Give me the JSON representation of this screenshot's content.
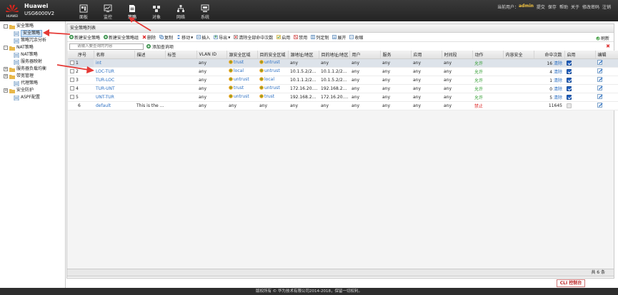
{
  "header": {
    "brand_name": "Huawei",
    "brand_model": "USG6000V2",
    "logo_text": "HUAWEI",
    "nav": [
      {
        "label": "面板",
        "icon": "dashboard-icon"
      },
      {
        "label": "监控",
        "icon": "monitor-icon"
      },
      {
        "label": "策略",
        "icon": "policy-icon"
      },
      {
        "label": "对象",
        "icon": "object-icon"
      },
      {
        "label": "网络",
        "icon": "network-icon"
      },
      {
        "label": "系统",
        "icon": "system-icon"
      }
    ],
    "current_user_label": "当前用户：",
    "current_user": "admin",
    "links": [
      "提交",
      "保存",
      "帮助",
      "关于",
      "修改密码",
      "注销"
    ]
  },
  "sidebar": {
    "items": [
      {
        "label": "安全策略",
        "level": 1,
        "expand": "-"
      },
      {
        "label": "安全策略",
        "level": 2,
        "selected": true
      },
      {
        "label": "策略冗余分析",
        "level": 2
      },
      {
        "label": "NAT策略",
        "level": 1,
        "expand": "-"
      },
      {
        "label": "NAT策略",
        "level": 2
      },
      {
        "label": "服务器映射",
        "level": 2
      },
      {
        "label": "服务器负载均衡",
        "level": 1,
        "expand": "+"
      },
      {
        "label": "带宽管理",
        "level": 1,
        "expand": "+"
      },
      {
        "label": "代理策略",
        "level": 2
      },
      {
        "label": "安全防护",
        "level": 1,
        "expand": "+"
      },
      {
        "label": "ASPF配置",
        "level": 2
      }
    ]
  },
  "panel": {
    "title": "安全策略列表",
    "toolbar": {
      "new_policy": "新建安全策略",
      "new_group": "新建安全策略组",
      "delete": "删除",
      "copy": "复制",
      "move": "移动",
      "insert": "插入",
      "export": "导出",
      "clear_hits": "清除全部命中次数",
      "enable": "启用",
      "disable": "禁用",
      "list_custom": "列定制",
      "expand": "展开",
      "collapse": "收缩",
      "refresh": "刷新"
    },
    "search_placeholder": "请输入要查询的内容",
    "add_query": "添加查询项",
    "columns": [
      "序号",
      "名称",
      "描述",
      "标签",
      "VLAN ID",
      "源安全区域",
      "目的安全区域",
      "源地址/地区",
      "目的地址/地区",
      "用户",
      "服务",
      "应用",
      "时间段",
      "动作",
      "内容安全",
      "命中次数",
      "启用",
      "编辑"
    ],
    "clear_label": "清除",
    "rows": [
      {
        "no": "1",
        "name": "int",
        "desc": "",
        "tag": "",
        "vlan": "any",
        "src_zone": "trust",
        "dst_zone": "untrust",
        "src_addr": "any",
        "dst_addr": "any",
        "user": "any",
        "service": "any",
        "app": "any",
        "time": "any",
        "action": "允许",
        "content": "",
        "hits": "16",
        "enabled": true,
        "selected": true
      },
      {
        "no": "2",
        "name": "LOC-TUR",
        "desc": "",
        "tag": "",
        "vlan": "any",
        "src_zone": "local",
        "dst_zone": "untrust",
        "src_addr": "10.1.5.2/255...",
        "dst_addr": "10.1.1.2/255...",
        "user": "any",
        "service": "any",
        "app": "any",
        "time": "any",
        "action": "允许",
        "content": "",
        "hits": "4",
        "enabled": true
      },
      {
        "no": "3",
        "name": "TUR-LOC",
        "desc": "",
        "tag": "",
        "vlan": "any",
        "src_zone": "untrust",
        "dst_zone": "local",
        "src_addr": "10.1.1.2/255...",
        "dst_addr": "10.1.5.2/255...",
        "user": "any",
        "service": "any",
        "app": "any",
        "time": "any",
        "action": "允许",
        "content": "",
        "hits": "1",
        "enabled": true
      },
      {
        "no": "4",
        "name": "TUR-UNT",
        "desc": "",
        "tag": "",
        "vlan": "any",
        "src_zone": "trust",
        "dst_zone": "untrust",
        "src_addr": "172.16.20.0/...",
        "dst_addr": "192.168.20.0/...",
        "user": "any",
        "service": "any",
        "app": "any",
        "time": "any",
        "action": "允许",
        "content": "",
        "hits": "0",
        "enabled": true
      },
      {
        "no": "5",
        "name": "UNT-TUR",
        "desc": "",
        "tag": "",
        "vlan": "any",
        "src_zone": "untrust",
        "dst_zone": "trust",
        "src_addr": "192.168.20.0/...",
        "dst_addr": "172.16.20.0/...",
        "user": "any",
        "service": "any",
        "app": "any",
        "time": "any",
        "action": "允许",
        "content": "",
        "hits": "5",
        "enabled": true
      },
      {
        "no": "6",
        "name": "default",
        "desc": "This is the de...",
        "tag": "",
        "vlan": "any",
        "src_zone": "any",
        "dst_zone": "any",
        "src_addr": "any",
        "dst_addr": "any",
        "user": "any",
        "service": "any",
        "app": "any",
        "time": "any",
        "action": "禁止",
        "content": "",
        "hits": "11645",
        "enabled": false,
        "default": true
      }
    ],
    "total": "共 6 条"
  },
  "cli_label": "CLI 控制台",
  "copyright": "版权所有 © 华为技术有限公司2014-2018，保留一切权利。",
  "colors": {
    "accent": "#2b6fc2",
    "permit": "#2a9a2a",
    "deny": "#d22222",
    "annotation_arrow": "#e53935"
  }
}
